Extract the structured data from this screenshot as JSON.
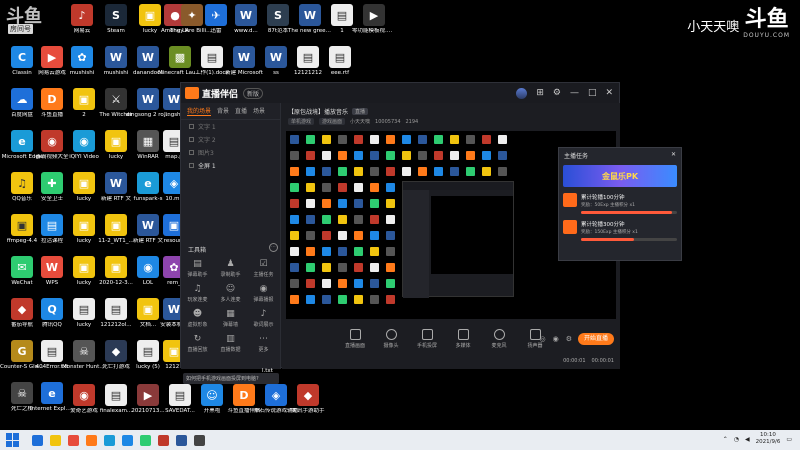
{
  "watermark": {
    "logo_left": "斗鱼",
    "room_label": "房间号",
    "streamer": "小天天噢",
    "logo_right": "斗鱼",
    "logo_right_sub": "DOUYU.COM"
  },
  "desktop_icons": [
    {
      "label": "网易云",
      "color": "#c0392b",
      "glyph": "♪"
    },
    {
      "label": "Steam",
      "color": "#1b2838",
      "glyph": "S"
    },
    {
      "label": "lucky",
      "color": "#f1c40f",
      "glyph": "▣"
    },
    {
      "label": "Among Us",
      "color": "#b23a3a",
      "glyph": "●"
    },
    {
      "label": "They Are Billions",
      "color": "#8a5a2b",
      "glyph": "✦"
    },
    {
      "label": "迅雷",
      "color": "#1e6fd9",
      "glyph": "✈"
    },
    {
      "label": "www.d...",
      "color": "#2b579a",
      "glyph": "W"
    },
    {
      "label": "05月份",
      "color": "#2b579a",
      "glyph": "W"
    },
    {
      "label": "87t范本",
      "color": "#2d3e50",
      "glyph": "S"
    },
    {
      "label": "The new green rev...",
      "color": "#2b579a",
      "glyph": "W"
    },
    {
      "label": "1",
      "color": "#eeeeee",
      "glyph": "▤"
    },
    {
      "label": "零功能模板视.mp4",
      "color": "#333333",
      "glyph": "▶"
    }
  ],
  "desktop_col1": [
    {
      "label": "Classin",
      "color": "#1e88e5",
      "glyph": "C"
    },
    {
      "label": "百度网盘",
      "color": "#1e6fd9",
      "glyph": "☁"
    },
    {
      "label": "Microsoft Edge",
      "color": "#1a9bd7",
      "glyph": "e"
    },
    {
      "label": "QQ音乐",
      "color": "#f1c40f",
      "glyph": "♫"
    },
    {
      "label": "ffmpeg-4.4",
      "color": "#f1c40f",
      "glyph": "▣"
    },
    {
      "label": "WeChat",
      "color": "#2ecc71",
      "glyph": "✉"
    },
    {
      "label": "番茄导航",
      "color": "#c0392b",
      "glyph": "◆"
    },
    {
      "label": "Counter-S Global Off...",
      "color": "#b58a1b",
      "glyph": "G"
    },
    {
      "label": "死亡之桥",
      "color": "#444444",
      "glyph": "☠"
    }
  ],
  "desktop_col2": [
    {
      "label": "网易云游戏",
      "color": "#e74c3c",
      "glyph": "▶"
    },
    {
      "label": "斗鱼直播",
      "color": "#ff7a1a",
      "glyph": "D"
    },
    {
      "label": "毒霸视频大全",
      "color": "#c0392b",
      "glyph": "◉"
    },
    {
      "label": "安全卫士",
      "color": "#2ecc71",
      "glyph": "✚"
    },
    {
      "label": "拉活课程",
      "color": "#1e88e5",
      "glyph": "▤"
    },
    {
      "label": "WPS",
      "color": "#e74c3c",
      "glyph": "W"
    },
    {
      "label": "腾讯QQ",
      "color": "#1e88e5",
      "glyph": "Q"
    },
    {
      "label": "404Error.txt",
      "color": "#eeeeee",
      "glyph": "▤"
    },
    {
      "label": "Internet Explorer",
      "color": "#1e6fd9",
      "glyph": "e"
    }
  ],
  "app": {
    "title": "直播伴侣",
    "version": "新版",
    "scene_tabs": [
      "我的场景",
      "背景",
      "直播",
      "场景"
    ],
    "sources": [
      {
        "label": "文字 1",
        "selected": false
      },
      {
        "label": "文字 2",
        "selected": false
      },
      {
        "label": "图片3",
        "selected": false
      },
      {
        "label": "全屏 1",
        "selected": true
      }
    ],
    "tools_title": "工具箱",
    "tools": [
      {
        "label": "弹幕助手",
        "icon": "chat-icon"
      },
      {
        "label": "录制助手",
        "icon": "user-icon"
      },
      {
        "label": "主播任务",
        "icon": "task-icon"
      },
      {
        "label": "玩家连麦",
        "icon": "mic-icon"
      },
      {
        "label": "多人连麦",
        "icon": "group-icon"
      },
      {
        "label": "弹幕播报",
        "icon": "speaker-icon"
      },
      {
        "label": "虚拟形象",
        "icon": "avatar-icon"
      },
      {
        "label": "弹幕墙",
        "icon": "wall-icon"
      },
      {
        "label": "歌词展示",
        "icon": "music-icon"
      },
      {
        "label": "直播回放",
        "icon": "replay-icon"
      },
      {
        "label": "直播数据",
        "icon": "data-icon"
      },
      {
        "label": "更多",
        "icon": "more-icon"
      }
    ],
    "tip": "如何把手机游戏画面投屏到电脑?",
    "room_title": "【原包战境】播放音乐",
    "room_tag": "直播",
    "room_meta": [
      "单机游戏",
      "游戏画面",
      "小天天噢",
      "10005734",
      "2194"
    ],
    "bottom_tools": [
      "直播画面",
      "摄像头",
      "手机投屏",
      "多媒体",
      "麦克风",
      "扬声器"
    ],
    "start_live": "开始直播",
    "timers": [
      "00:00:01",
      "00:00:01"
    ]
  },
  "tasks_popup": {
    "title": "主播任务",
    "banner": "金鼠乐PK",
    "items": [
      {
        "title": "累计轮播100分钟",
        "sub": "奖励：50Exp 主播积分 x1",
        "progress": 0.95
      },
      {
        "title": "累计轮播300分钟",
        "sub": "奖励：150Exp 主播积分 x1",
        "progress": 0.55
      }
    ]
  },
  "under_label": "l.txt",
  "taskbar": {
    "apps_colors": [
      "#1e6fd9",
      "#f1c40f",
      "#e74c3c",
      "#ff7a1a",
      "#1a9bd7",
      "#1e88e5",
      "#2ecc71",
      "#c0392b",
      "#2b579a",
      "#444444"
    ],
    "time": "10:10",
    "date": "2021/9/6"
  }
}
